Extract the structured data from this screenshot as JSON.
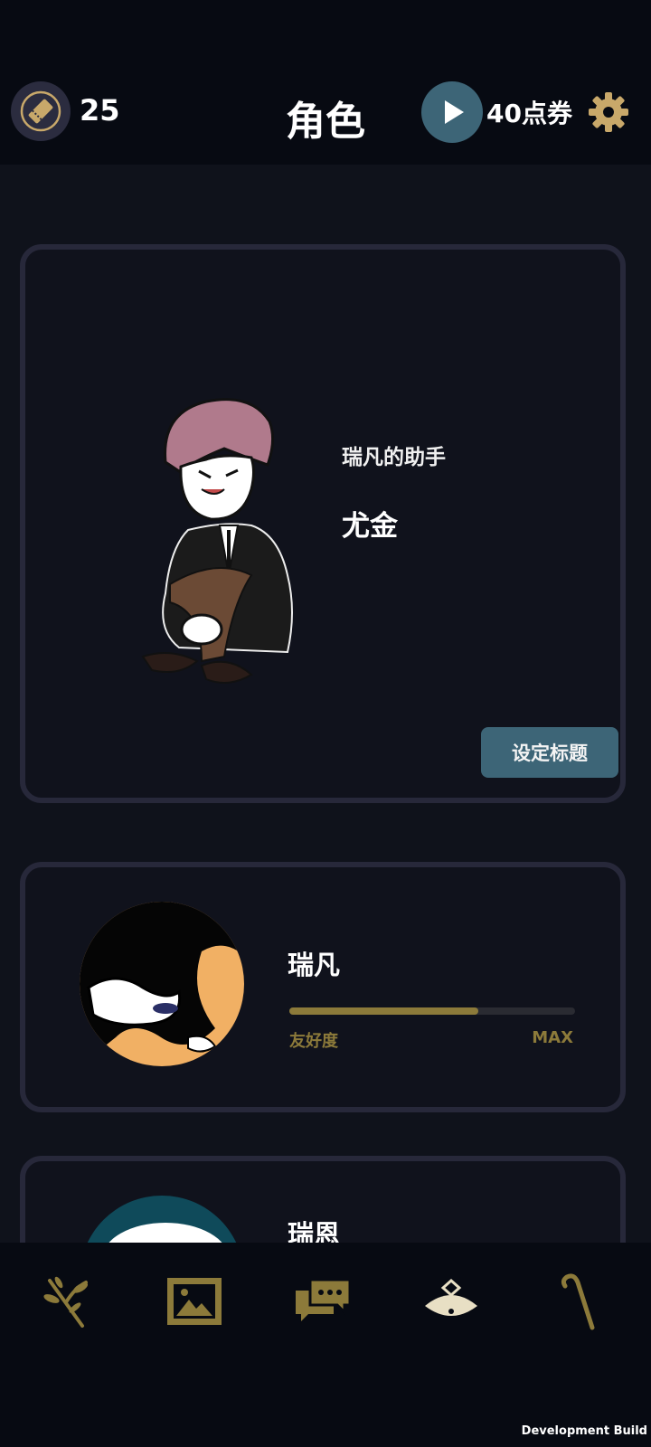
{
  "header": {
    "ticket_count": "25",
    "title": "角色",
    "points_label": "40点券"
  },
  "featured": {
    "subtitle": "瑞凡的助手",
    "name": "尤金",
    "set_title_button": "设定标题"
  },
  "characters": [
    {
      "name": "瑞凡",
      "affinity_label": "友好度",
      "affinity_status": "MAX",
      "affinity_progress": 0.66
    },
    {
      "name": "瑞恩"
    }
  ],
  "nav": {
    "items": [
      "branch-icon",
      "gallery-icon",
      "chat-icon",
      "fan-icon",
      "cane-icon"
    ]
  },
  "footer": {
    "build_label": "Development Build"
  },
  "colors": {
    "accent_gold": "#8c7a3a",
    "button_teal": "#3d6577",
    "card_border": "#27283a"
  }
}
